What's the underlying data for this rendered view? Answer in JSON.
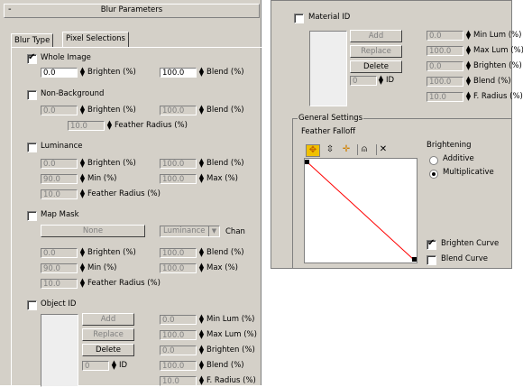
{
  "left_panel": {
    "rollout_minus": "-",
    "rollout_title": "Blur Parameters",
    "tabs": [
      "Blur Type",
      "Pixel Selections"
    ],
    "whole_image": {
      "label": "Whole Image",
      "checked": true,
      "brighten": "0.0",
      "brighten_label": "Brighten (%)",
      "blend": "100.0",
      "blend_label": "Blend (%)"
    },
    "non_background": {
      "label": "Non-Background",
      "checked": false,
      "brighten": "0.0",
      "brighten_label": "Brighten (%)",
      "blend": "100.0",
      "blend_label": "Blend (%)",
      "feather": "10.0",
      "feather_label": "Feather Radius (%)"
    },
    "luminance": {
      "label": "Luminance",
      "checked": false,
      "brighten": "0.0",
      "brighten_label": "Brighten (%)",
      "blend": "100.0",
      "blend_label": "Blend (%)",
      "min": "90.0",
      "min_label": "Min (%)",
      "max": "100.0",
      "max_label": "Max (%)",
      "feather": "10.0",
      "feather_label": "Feather Radius (%)"
    },
    "map_mask": {
      "label": "Map Mask",
      "checked": false,
      "none_button": "None",
      "channel_select": "Luminance",
      "chan_label": "Chan",
      "brighten": "0.0",
      "brighten_label": "Brighten (%)",
      "blend": "100.0",
      "blend_label": "Blend (%)",
      "min": "90.0",
      "min_label": "Min (%)",
      "max": "100.0",
      "max_label": "Max (%)",
      "feather": "10.0",
      "feather_label": "Feather Radius (%)"
    },
    "object_id": {
      "label": "Object ID",
      "checked": false,
      "add": "Add",
      "replace": "Replace",
      "delete": "Delete",
      "id_value": "0",
      "id_label": "ID",
      "min_lum": "0.0",
      "min_lum_label": "Min Lum (%)",
      "max_lum": "100.0",
      "max_lum_label": "Max Lum (%)",
      "brighten": "0.0",
      "brighten_label": "Brighten (%)",
      "blend": "100.0",
      "blend_label": "Blend (%)",
      "f_radius": "10.0",
      "f_radius_label": "F. Radius (%)"
    }
  },
  "right_panel": {
    "material_id": {
      "label": "Material ID",
      "checked": false,
      "add": "Add",
      "replace": "Replace",
      "delete": "Delete",
      "id_value": "0",
      "id_label": "ID",
      "min_lum": "0.0",
      "min_lum_label": "Min Lum (%)",
      "max_lum": "100.0",
      "max_lum_label": "Max Lum (%)",
      "brighten": "0.0",
      "brighten_label": "Brighten (%)",
      "blend": "100.0",
      "blend_label": "Blend (%)",
      "f_radius": "10.0",
      "f_radius_label": "F. Radius (%)"
    },
    "general_settings": {
      "title": "General Settings",
      "feather_falloff": "Feather Falloff",
      "toolbar_icons": [
        "move-icon",
        "scale-point-icon",
        "add-point-icon",
        "lock-icon",
        "delete-point-icon"
      ],
      "brightening_label": "Brightening",
      "additive": "Additive",
      "multiplicative": "Multiplicative",
      "selected": "Multiplicative",
      "brighten_curve": {
        "label": "Brighten Curve",
        "checked": true
      },
      "blend_curve": {
        "label": "Blend Curve",
        "checked": false
      },
      "curve_color": "#ff0000"
    }
  }
}
